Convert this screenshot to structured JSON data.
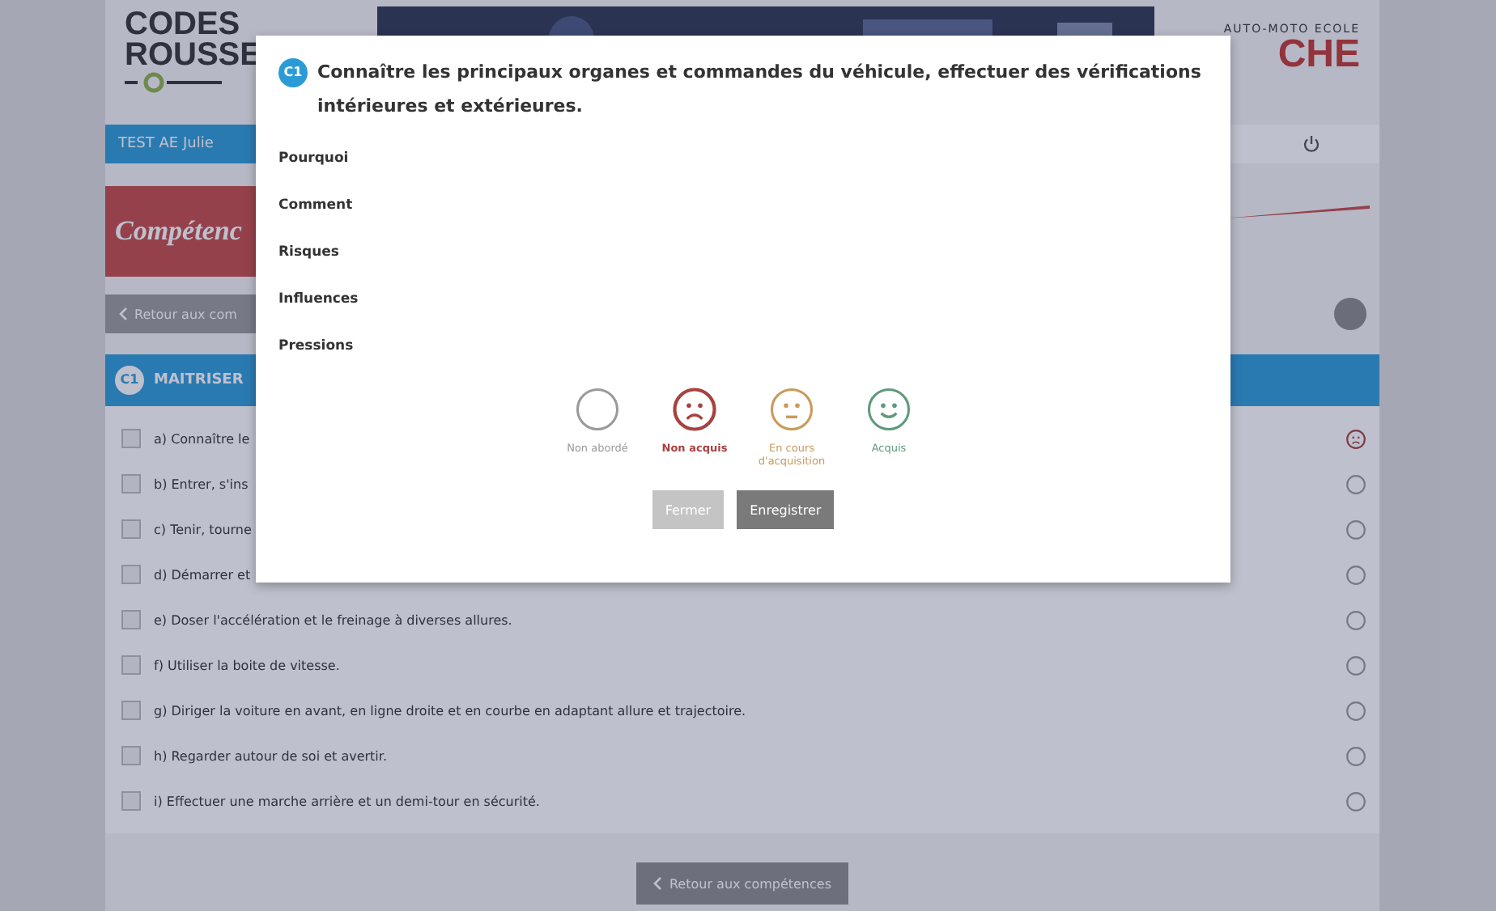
{
  "header": {
    "logo_left": [
      "CODES",
      "ROUSSE"
    ],
    "logo_right": {
      "caption": "AUTO-MOTO ECOLE",
      "name": "CHE"
    }
  },
  "user_bar": {
    "user": "TEST AE Julie"
  },
  "banner": {
    "title": "Compétenc"
  },
  "back_link": {
    "label": "Retour aux com"
  },
  "section": {
    "badge": "C1",
    "title": "MAITRISER"
  },
  "items": [
    {
      "label": "a) Connaître le",
      "kind": "sad",
      "checked": false
    },
    {
      "label": "b) Entrer, s'ins",
      "kind": "empty",
      "checked": false
    },
    {
      "label": "c) Tenir, tourne",
      "kind": "empty",
      "checked": false
    },
    {
      "label": "d) Démarrer et",
      "kind": "empty",
      "checked": false
    },
    {
      "label": "e) Doser l'accélération et le freinage à diverses allures.",
      "kind": "empty",
      "checked": false
    },
    {
      "label": "f) Utiliser la boite de vitesse.",
      "kind": "empty",
      "checked": false
    },
    {
      "label": "g) Diriger la voiture en avant, en ligne droite et en courbe en adaptant allure et trajectoire.",
      "kind": "empty",
      "checked": false
    },
    {
      "label": "h) Regarder autour de soi et avertir.",
      "kind": "empty",
      "checked": false
    },
    {
      "label": "i) Effectuer une marche arrière et un demi-tour en sécurité.",
      "kind": "empty",
      "checked": false
    }
  ],
  "bottom_button": {
    "label": "Retour aux compétences"
  },
  "modal": {
    "badge": "C1",
    "title": "Connaître les principaux organes et commandes du véhicule, effectuer des vérifications intérieures et extérieures.",
    "fields": [
      "Pourquoi",
      "Comment",
      "Risques",
      "Influences",
      "Pressions"
    ],
    "ratings": [
      {
        "label": "Non abordé",
        "kind": "empty",
        "color": "#9a9a9a",
        "selected": false
      },
      {
        "label": "Non acquis",
        "kind": "sad",
        "color": "#a8423f",
        "selected": true
      },
      {
        "label": "En cours d'acquisition",
        "kind": "neutral",
        "color": "#c99a5a",
        "selected": false
      },
      {
        "label": "Acquis",
        "kind": "happy",
        "color": "#5f9a7c",
        "selected": false
      }
    ],
    "buttons": [
      {
        "label": "Fermer",
        "kind": "secondary"
      },
      {
        "label": "Enregistrer",
        "kind": "primary"
      }
    ]
  }
}
